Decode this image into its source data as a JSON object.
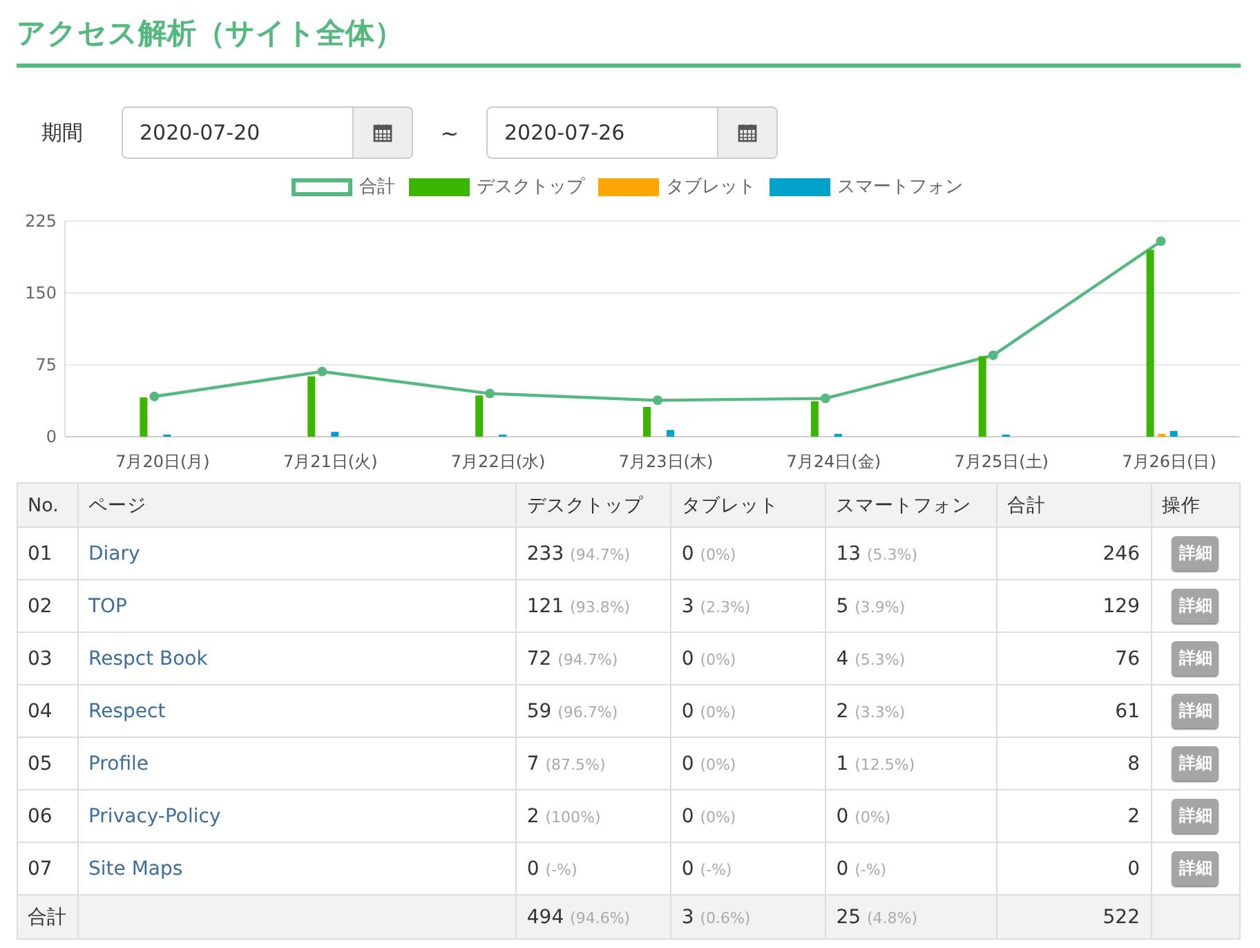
{
  "title": "アクセス解析（サイト全体）",
  "period": {
    "label": "期間",
    "start": "2020-07-20",
    "separator": "~",
    "end": "2020-07-26"
  },
  "chart_data": {
    "type": "bar",
    "stacked": false,
    "categories": [
      "7月20日(月)",
      "7月21日(火)",
      "7月22日(水)",
      "7月23日(木)",
      "7月24日(金)",
      "7月25日(土)",
      "7月26日(日)"
    ],
    "ylim": [
      0,
      225
    ],
    "yticks": [
      0,
      75,
      150,
      225
    ],
    "series": [
      {
        "name": "合計",
        "color": "#55b97f",
        "type": "line",
        "marker": "circle",
        "values": [
          42,
          68,
          45,
          38,
          40,
          85,
          204
        ]
      },
      {
        "name": "デスクトップ",
        "color": "#3cb500",
        "values": [
          41,
          63,
          43,
          31,
          37,
          84,
          195
        ]
      },
      {
        "name": "タブレット",
        "color": "#ffa600",
        "values": [
          0,
          0,
          0,
          0,
          0,
          0,
          3
        ]
      },
      {
        "name": "スマートフォン",
        "color": "#00a2cc",
        "values": [
          1,
          5,
          2,
          7,
          3,
          1,
          6
        ]
      }
    ]
  },
  "table": {
    "columns": [
      "No.",
      "ページ",
      "デスクトップ",
      "タブレット",
      "スマートフォン",
      "合計",
      "操作"
    ],
    "rows": [
      {
        "no": "01",
        "page": "Diary",
        "desktop": {
          "value": "233",
          "share": "(94.7%)"
        },
        "tablet": {
          "value": "0",
          "share": "(0%)"
        },
        "smartphone": {
          "value": "13",
          "share": "(5.3%)"
        },
        "total": "246",
        "action": "詳細"
      },
      {
        "no": "02",
        "page": "TOP",
        "desktop": {
          "value": "121",
          "share": "(93.8%)"
        },
        "tablet": {
          "value": "3",
          "share": "(2.3%)"
        },
        "smartphone": {
          "value": "5",
          "share": "(3.9%)"
        },
        "total": "129",
        "action": "詳細"
      },
      {
        "no": "03",
        "page": "Respct Book",
        "desktop": {
          "value": "72",
          "share": "(94.7%)"
        },
        "tablet": {
          "value": "0",
          "share": "(0%)"
        },
        "smartphone": {
          "value": "4",
          "share": "(5.3%)"
        },
        "total": "76",
        "action": "詳細"
      },
      {
        "no": "04",
        "page": "Respect",
        "desktop": {
          "value": "59",
          "share": "(96.7%)"
        },
        "tablet": {
          "value": "0",
          "share": "(0%)"
        },
        "smartphone": {
          "value": "2",
          "share": "(3.3%)"
        },
        "total": "61",
        "action": "詳細"
      },
      {
        "no": "05",
        "page": "Profile",
        "desktop": {
          "value": "7",
          "share": "(87.5%)"
        },
        "tablet": {
          "value": "0",
          "share": "(0%)"
        },
        "smartphone": {
          "value": "1",
          "share": "(12.5%)"
        },
        "total": "8",
        "action": "詳細"
      },
      {
        "no": "06",
        "page": "Privacy-Policy",
        "desktop": {
          "value": "2",
          "share": "(100%)"
        },
        "tablet": {
          "value": "0",
          "share": "(0%)"
        },
        "smartphone": {
          "value": "0",
          "share": "(0%)"
        },
        "total": "2",
        "action": "詳細"
      },
      {
        "no": "07",
        "page": "Site Maps",
        "desktop": {
          "value": "0",
          "share": "(-%)"
        },
        "tablet": {
          "value": "0",
          "share": "(-%)"
        },
        "smartphone": {
          "value": "0",
          "share": "(-%)"
        },
        "total": "0",
        "action": "詳細"
      }
    ],
    "footer": {
      "label": "合計",
      "desktop": {
        "value": "494",
        "share": "(94.6%)"
      },
      "tablet": {
        "value": "3",
        "share": "(0.6%)"
      },
      "smartphone": {
        "value": "25",
        "share": "(4.8%)"
      },
      "total": "522"
    }
  }
}
